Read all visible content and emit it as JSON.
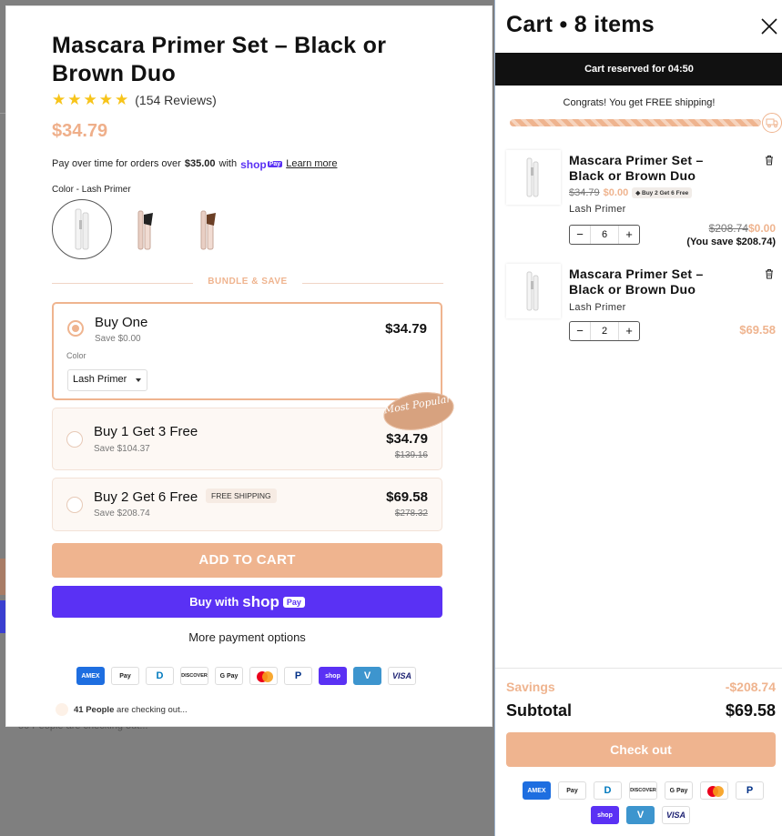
{
  "product": {
    "title": "Mascara Primer Set – Black or Brown Duo",
    "reviews": "(154 Reviews)",
    "price": "$34.79",
    "installments_prefix": "Pay over time for orders over",
    "installments_amount": "$35.00",
    "installments_with": "with",
    "shoppay_word": "shop",
    "shoppay_badge": "Pay",
    "learn_more": "Learn more",
    "color_label": "Color - Lash Primer",
    "bundle_heading": "BUNDLE & SAVE",
    "rating_stars": 5
  },
  "bundles": [
    {
      "name": "Buy One",
      "save": "Save $0.00",
      "price": "$34.79",
      "color_label": "Color",
      "select_value": "Lash Primer"
    },
    {
      "name": "Buy 1 Get 3 Free",
      "save": "Save $104.37",
      "price": "$34.79",
      "compare": "$139.16",
      "badge": "Most Popular"
    },
    {
      "name": "Buy 2 Get 6 Free",
      "save": "Save $208.74",
      "price": "$69.58",
      "compare": "$278.32",
      "badge": "FREE SHIPPING"
    }
  ],
  "buttons": {
    "add_to_cart": "ADD TO CART",
    "buy_with": "Buy with",
    "shop_word": "shop",
    "pay_word": "Pay",
    "more_payment": "More payment options"
  },
  "checking_out": {
    "count": "41 People",
    "suffix": "are checking out..."
  },
  "background": {
    "text": "50 People are checking out..."
  },
  "payment_icons": [
    "AMEX",
    "Pay",
    "D",
    "DISCOVER",
    "G Pay",
    "mastercard",
    "P",
    "shop",
    "V",
    "VISA"
  ],
  "cart": {
    "title": "Cart • 8 items",
    "reserved": "Cart reserved for 04:50",
    "congrats": "Congrats! You get FREE shipping!",
    "items": [
      {
        "name": "Mascara Primer Set – Black or Brown Duo",
        "compare": "$34.79",
        "price": "$0.00",
        "badge": "Buy 2 Get 6 Free",
        "variant": "Lash Primer",
        "qty": "6",
        "line_compare": "$208.74",
        "line_price": "$0.00",
        "you_save": "(You save $208.74)"
      },
      {
        "name": "Mascara Primer Set – Black or Brown Duo",
        "variant": "Lash Primer",
        "qty": "2",
        "line_price": "$69.58"
      }
    ],
    "savings_label": "Savings",
    "savings_value": "-$208.74",
    "subtotal_label": "Subtotal",
    "subtotal_value": "$69.58",
    "checkout": "Check out"
  },
  "colors": {
    "accent": "#efb48f",
    "shoppay": "#5a31f4",
    "star": "#f7c41a"
  }
}
